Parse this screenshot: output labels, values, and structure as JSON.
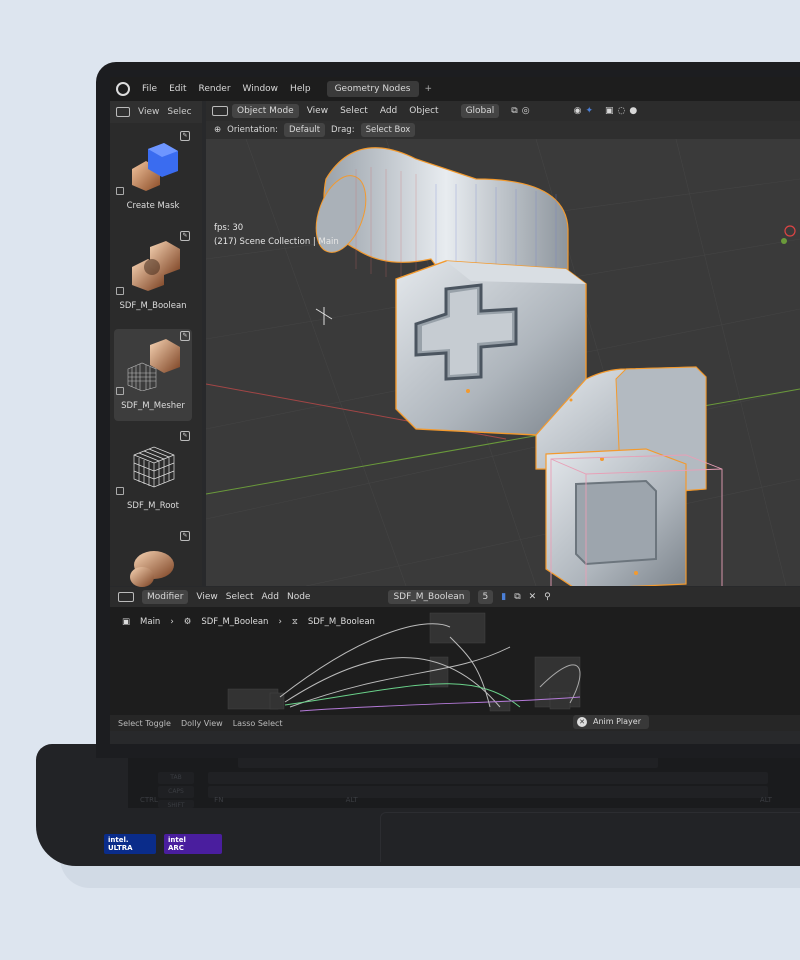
{
  "menu": {
    "file": "File",
    "edit": "Edit",
    "render": "Render",
    "window": "Window",
    "help": "Help",
    "workspace_tab": "Geometry Nodes",
    "add_tab": "+"
  },
  "shelf": {
    "view": "View",
    "select": "Selec",
    "assets": [
      {
        "label": "Create Mask"
      },
      {
        "label": "SDF_M_Boolean"
      },
      {
        "label": "SDF_M_Mesher"
      },
      {
        "label": "SDF_M_Root"
      },
      {
        "label": ""
      }
    ]
  },
  "viewport": {
    "mode": "Object Mode",
    "view": "View",
    "select": "Select",
    "add": "Add",
    "object": "Object",
    "transform": "Global",
    "orientation_label": "Orientation:",
    "orientation_value": "Default",
    "drag_label": "Drag:",
    "drag_value": "Select Box",
    "fps": "fps: 30",
    "collection": "(217) Scene Collection | Main"
  },
  "node_editor": {
    "modifier": "Modifier",
    "view": "View",
    "select": "Select",
    "add": "Add",
    "node": "Node",
    "tree_name": "SDF_M_Boolean",
    "users": "5",
    "breadcrumb": [
      "Main",
      "SDF_M_Boolean",
      "SDF_M_Boolean"
    ]
  },
  "status": {
    "select_toggle": "Select Toggle",
    "dolly_view": "Dolly View",
    "lasso_select": "Lasso Select",
    "anim_player": "Anim Player"
  },
  "keyboard": {
    "tab": "TAB",
    "caps": "CAPS",
    "shift": "SHIFT",
    "ctrl": "CTRL",
    "fn": "FN",
    "alt": "ALT",
    "alt2": "ALT"
  },
  "stickers": [
    {
      "line1": "intel.",
      "line2": "ULTRA"
    },
    {
      "line1": "intel",
      "line2": "ARC"
    }
  ],
  "colors": {
    "selection": "#f39a2e",
    "accent": "#4b7fd6",
    "background": "#dde5ef"
  }
}
